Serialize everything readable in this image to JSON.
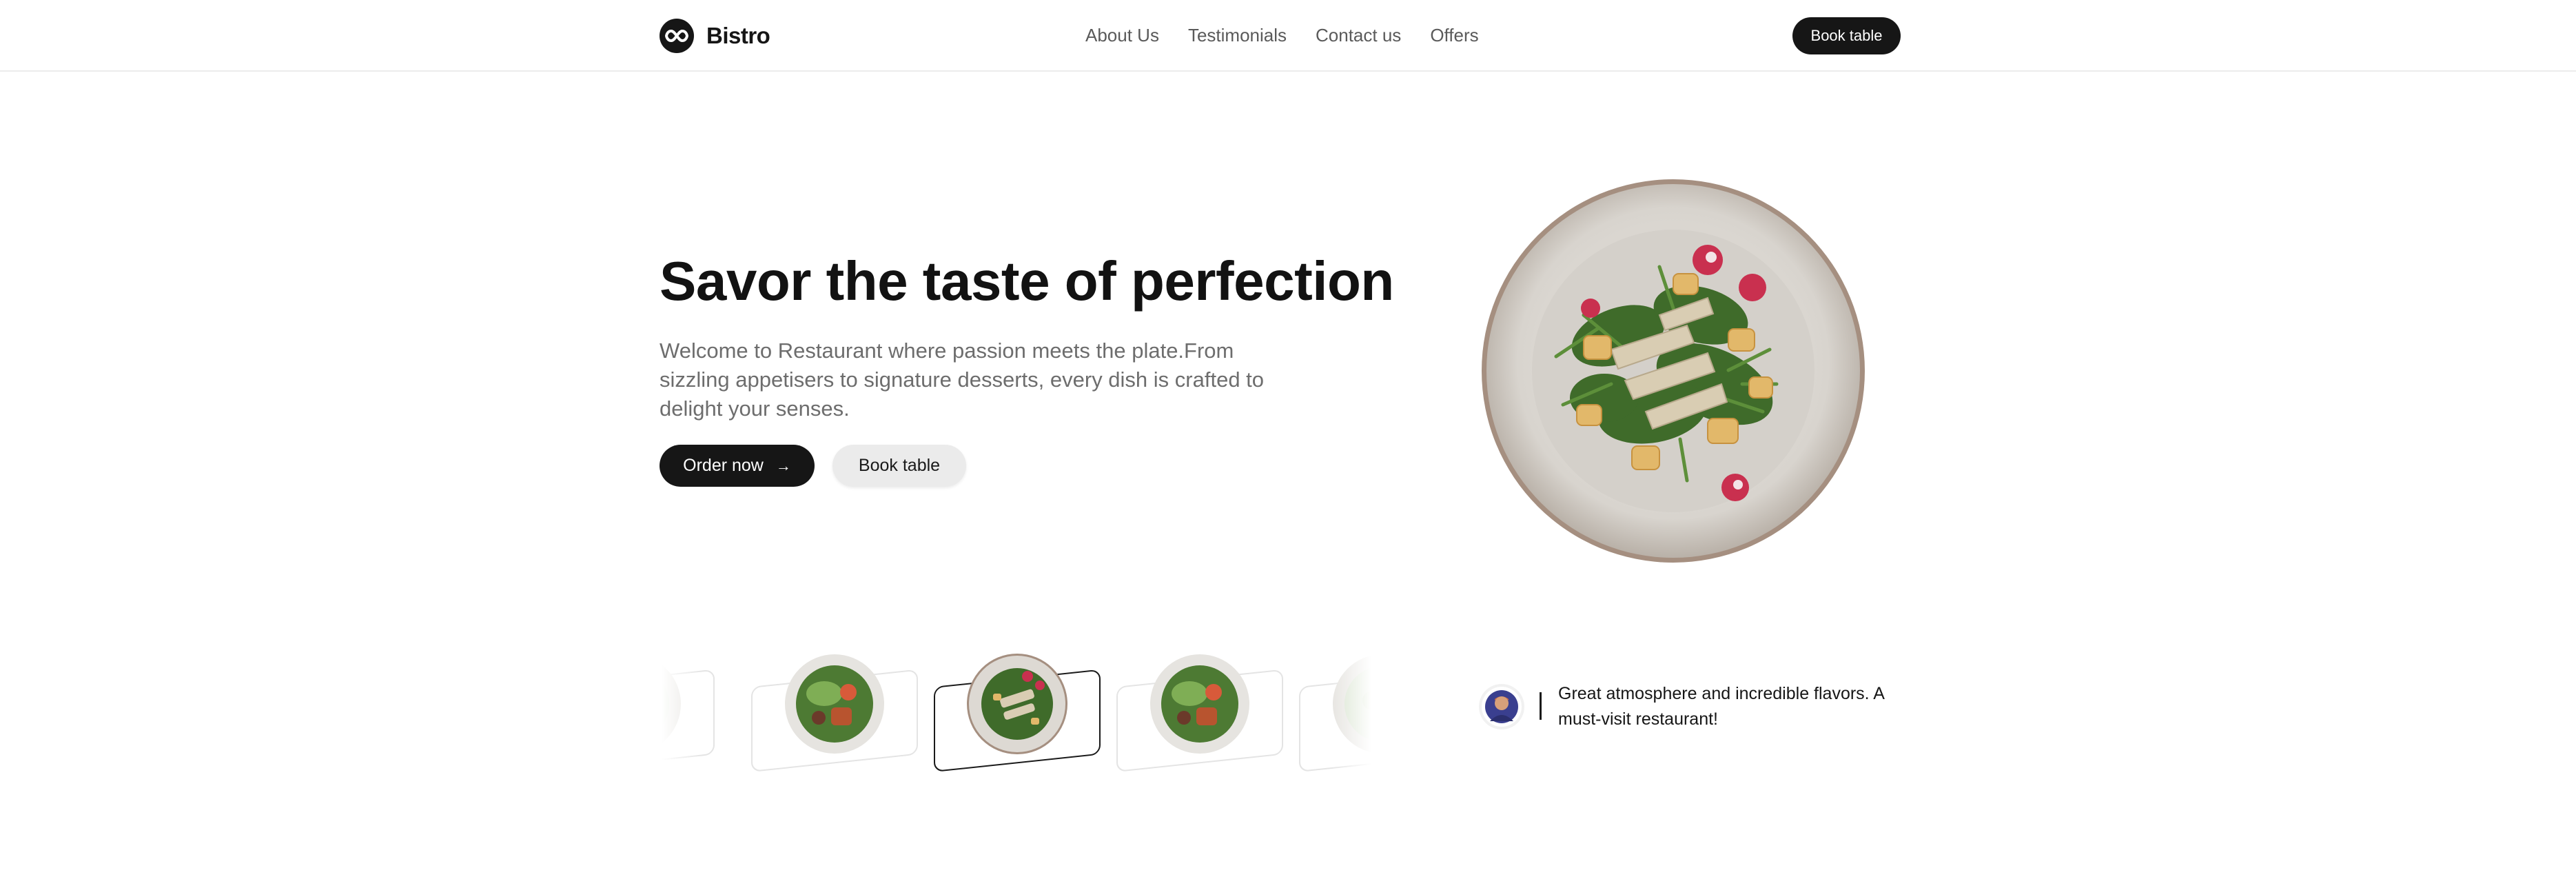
{
  "brand": {
    "name": "Bistro"
  },
  "nav": {
    "items": [
      "About Us",
      "Testimonials",
      "Contact us",
      "Offers"
    ]
  },
  "header": {
    "cta_label": "Book table"
  },
  "hero": {
    "title": "Savor the taste of perfection",
    "description": "Welcome to Restaurant where passion meets the plate.From sizzling appetisers to signature desserts, every dish is crafted to delight your senses.",
    "primary_button": "Order now",
    "secondary_button": "Book table",
    "arrow_glyph": "→"
  },
  "carousel": {
    "items": [
      {
        "dish": "salad",
        "active": false
      },
      {
        "dish": "greens-bowl",
        "active": false
      },
      {
        "dish": "chicken-salad",
        "active": true
      },
      {
        "dish": "greens-bowl",
        "active": false
      },
      {
        "dish": "salad",
        "active": false
      }
    ]
  },
  "testimonial": {
    "quote": "Great atmosphere and incredible flavors. A must-visit restaurant!"
  },
  "colors": {
    "primary": "#161616",
    "muted_text": "#6d6d6d",
    "light_button": "#ebebeb"
  }
}
